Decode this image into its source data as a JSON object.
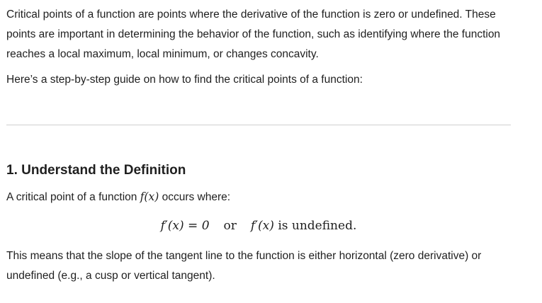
{
  "intro": {
    "text": "Critical points of a function are points where the derivative of the function is zero or undefined. These points are important in determining the behavior of the function, such as identifying where the function reaches a local maximum, local minimum, or changes concavity."
  },
  "guide": {
    "text": "Here’s a step-by-step guide on how to find the critical points of a function:"
  },
  "section1": {
    "heading": "1. Understand the Definition",
    "def_before": "A critical point of a function ",
    "def_math": "f(x)",
    "def_after": " occurs where:",
    "eq_left": "f′(x) = 0",
    "eq_or": "or",
    "eq_right_fn": "f′(x)",
    "eq_right_text": "is undefined.",
    "slope_text": "This means that the slope of the tangent line to the function is either horizontal (zero derivative) or undefined (e.g., a cusp or vertical tangent)."
  }
}
